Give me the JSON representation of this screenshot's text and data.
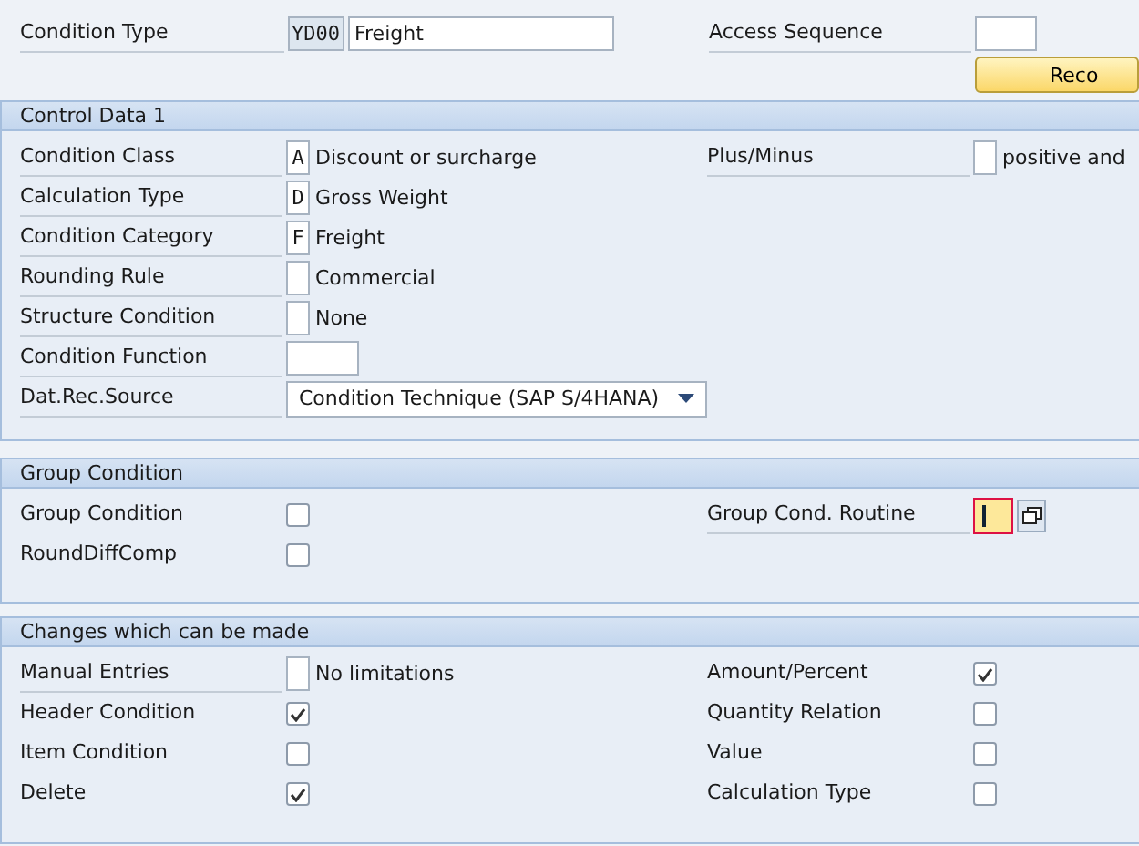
{
  "header": {
    "condition_type": {
      "label": "Condition Type",
      "code": "YD00",
      "description": "Freight"
    },
    "access_sequence": {
      "label": "Access Sequence"
    },
    "records_button": "Reco"
  },
  "sections": [
    {
      "title": "Control Data 1",
      "left": [
        {
          "kind": "code",
          "label": "Condition Class",
          "value": "A",
          "description": "Discount or surcharge"
        },
        {
          "kind": "code",
          "label": "Calculation Type",
          "value": "D",
          "description": "Gross Weight"
        },
        {
          "kind": "code",
          "label": "Condition Category",
          "value": "F",
          "description": "Freight"
        },
        {
          "kind": "code",
          "label": "Rounding Rule",
          "description": "Commercial"
        },
        {
          "kind": "code",
          "label": "Structure Condition",
          "description": "None"
        },
        {
          "kind": "input",
          "label": "Condition Function"
        },
        {
          "kind": "dropdown",
          "label": "Dat.Rec.Source",
          "value": "Condition Technique (SAP S/4HANA)"
        }
      ],
      "right": [
        {
          "kind": "code",
          "label": "Plus/Minus",
          "description": "positive and"
        }
      ]
    },
    {
      "title": "Group Condition",
      "left": [
        {
          "kind": "checkbox",
          "label": "Group Condition",
          "checked": false
        },
        {
          "kind": "checkbox",
          "label": "RoundDiffComp",
          "checked": false
        }
      ],
      "right": [
        {
          "kind": "focus",
          "label": "Group Cond. Routine"
        }
      ]
    },
    {
      "title": "Changes which can be made",
      "left": [
        {
          "kind": "code",
          "label": "Manual Entries",
          "description": "No limitations"
        },
        {
          "kind": "checkbox",
          "label": "Header Condition",
          "checked": true
        },
        {
          "kind": "checkbox",
          "label": "Item Condition",
          "checked": false
        },
        {
          "kind": "checkbox",
          "label": "Delete",
          "checked": true
        }
      ],
      "right": [
        {
          "kind": "checkbox",
          "label": "Amount/Percent",
          "checked": true
        },
        {
          "kind": "checkbox",
          "label": "Quantity Relation",
          "checked": false
        },
        {
          "kind": "checkbox",
          "label": "Value",
          "checked": false
        },
        {
          "kind": "checkbox",
          "label": "Calculation Type",
          "checked": false
        }
      ]
    }
  ]
}
